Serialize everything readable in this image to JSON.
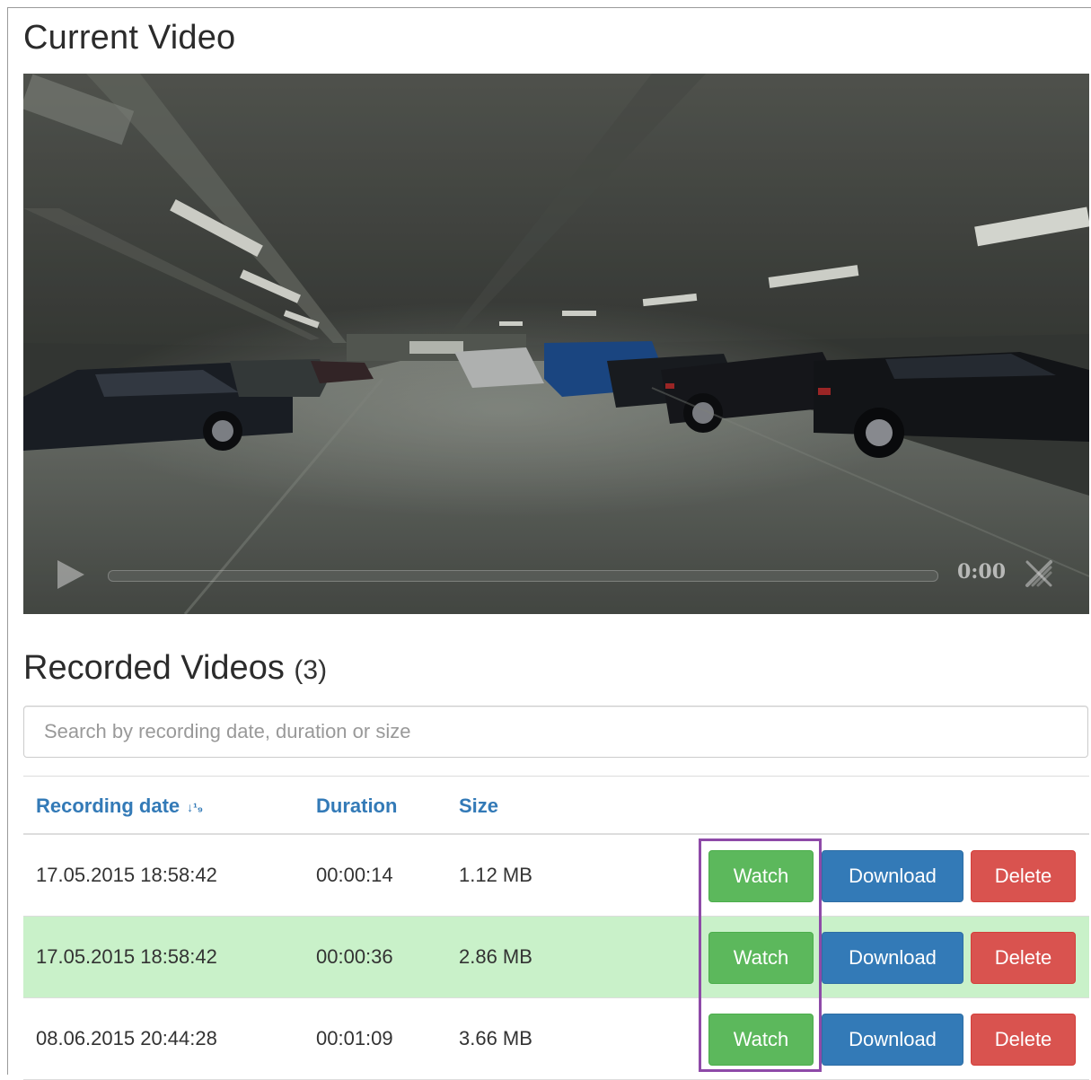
{
  "current_video": {
    "title": "Current Video",
    "player": {
      "time": "0:00",
      "progress": 0
    }
  },
  "recorded": {
    "title": "Recorded Videos",
    "count": "(3)",
    "search_placeholder": "Search by recording date, duration or size",
    "columns": {
      "date": "Recording date",
      "duration": "Duration",
      "size": "Size"
    },
    "sort_icon": "↓¹₉",
    "rows": [
      {
        "date": "17.05.2015 18:58:42",
        "duration": "00:00:14",
        "size": "1.12 MB"
      },
      {
        "date": "17.05.2015 18:58:42",
        "duration": "00:00:36",
        "size": "2.86 MB"
      },
      {
        "date": "08.06.2015 20:44:28",
        "duration": "00:01:09",
        "size": "3.66 MB"
      }
    ],
    "buttons": {
      "watch": "Watch",
      "download": "Download",
      "delete": "Delete"
    }
  },
  "colors": {
    "watch": "#5cb85c",
    "download": "#337ab7",
    "delete": "#d9534f",
    "highlight_row": "#c9f1c9",
    "callout": "#8e4aa8",
    "header_link": "#337ab7"
  }
}
